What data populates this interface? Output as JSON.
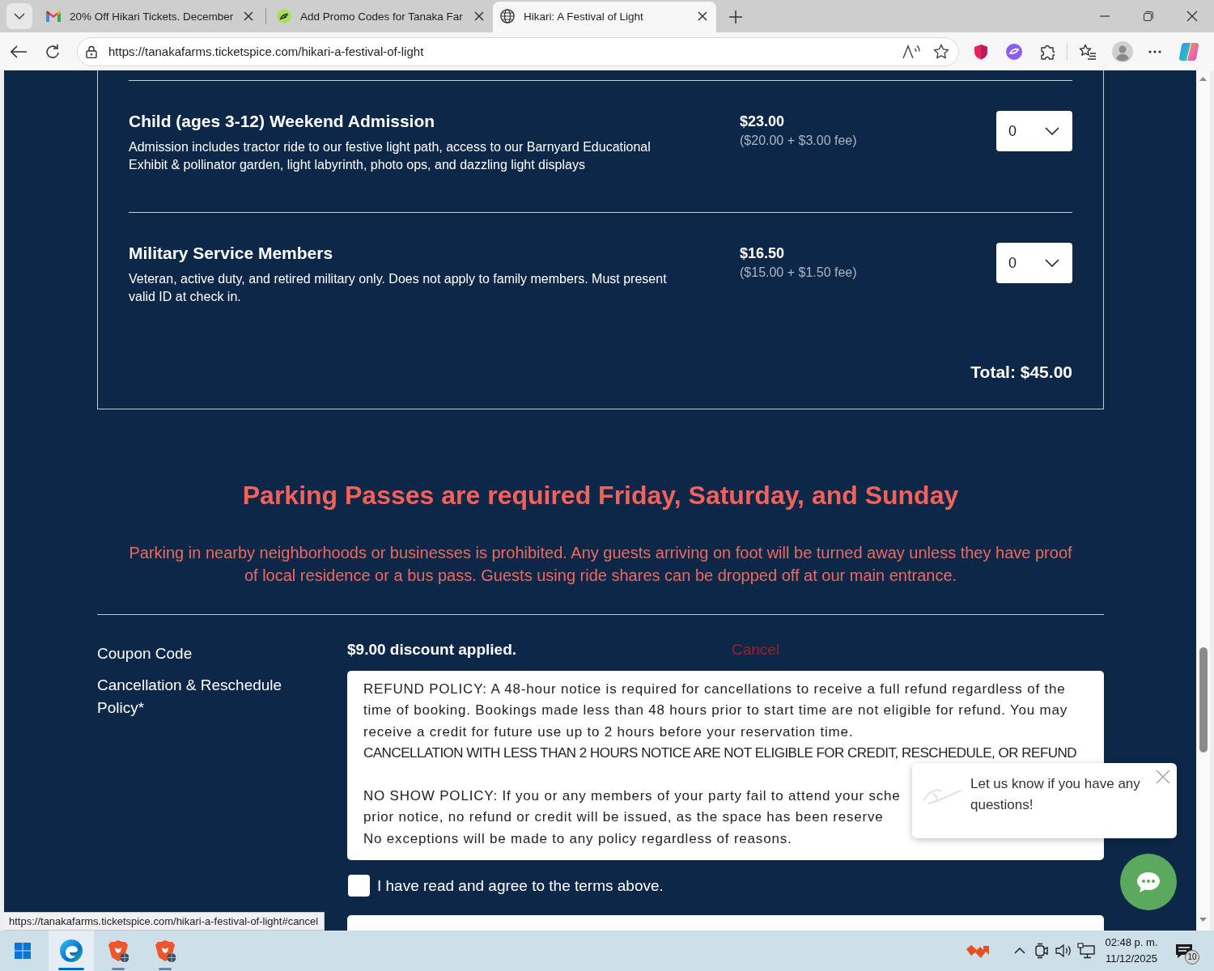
{
  "browser": {
    "tabs": [
      {
        "title": "20% Off Hikari Tickets. December",
        "selected": false
      },
      {
        "title": "Add Promo Codes for Tanaka Far",
        "selected": false
      },
      {
        "title": "Hikari: A Festival of Light",
        "selected": true
      }
    ],
    "address": "https://tanakafarms.ticketspice.com/hikari-a-festival-of-light"
  },
  "tickets": [
    {
      "name": "Child (ages 3-12) Weekend Admission",
      "description": "Admission includes tractor ride to our festive light path, access to our Barnyard Educational Exhibit & pollinator garden, light labyrinth, photo ops, and dazzling light displays",
      "price": "$23.00",
      "breakdown": "($20.00 + $3.00 fee)",
      "quantity": "0"
    },
    {
      "name": "Military Service Members",
      "description": "Veteran, active duty, and retired military only. Does not apply to family members. Must present valid ID at check in.",
      "price": "$16.50",
      "breakdown": "($15.00 + $1.50 fee)",
      "quantity": "0"
    }
  ],
  "total": "Total: $45.00",
  "parking_notice": {
    "heading": "Parking Passes are required Friday, Saturday, and Sunday",
    "text": "Parking in nearby neighborhoods or businesses is prohibited. Any guests arriving on foot will be turned away unless they have proof of local residence or a bus pass. Guests using ride shares can be dropped off at our main entrance."
  },
  "coupon": {
    "label": "Coupon Code",
    "message": "$9.00 discount applied.",
    "cancel_link": "Cancel"
  },
  "policy": {
    "label": "Cancellation & Reschedule Policy*",
    "sections": [
      {
        "blocks": [
          {
            "kind": "paragraph",
            "text": "REFUND POLICY: A 48-hour notice is required for cancellations to receive a full refund regardless of the time of booking. Bookings made less than 48 hours prior to start time are not eligible for refund. You may receive a credit for future use up to 2 hours before your reservation time."
          },
          {
            "kind": "caps",
            "text": "CANCELLATION WITH LESS THAN 2 HOURS NOTICE ARE NOT ELIGIBLE FOR CREDIT, RESCHEDULE, OR REFUND"
          }
        ]
      },
      {
        "blocks": [
          {
            "kind": "clipped",
            "text": "NO SHOW POLICY: If you or any members of your party fail to attend your sche"
          },
          {
            "kind": "clipped",
            "text": "prior notice, no refund or credit will be issued, as the space has been reserve"
          },
          {
            "kind": "paragraph",
            "text": "No exceptions will be made to any policy regardless of reasons."
          }
        ]
      }
    ]
  },
  "terms": {
    "label": "I have read and agree to the terms above.",
    "checked": false
  },
  "status_url": "https://tanakafarms.ticketspice.com/hikari-a-festival-of-light#cancel",
  "chat": {
    "message": "Let us know if you have any questions!"
  },
  "taskbar": {
    "apps": [
      {
        "kind": "swirl",
        "selected": true
      },
      {
        "kind": "shield",
        "selected": false
      },
      {
        "kind": "shield",
        "selected": false
      }
    ],
    "time": "02:48 p. m.",
    "date": "11/12/2025",
    "notifications": "10"
  }
}
